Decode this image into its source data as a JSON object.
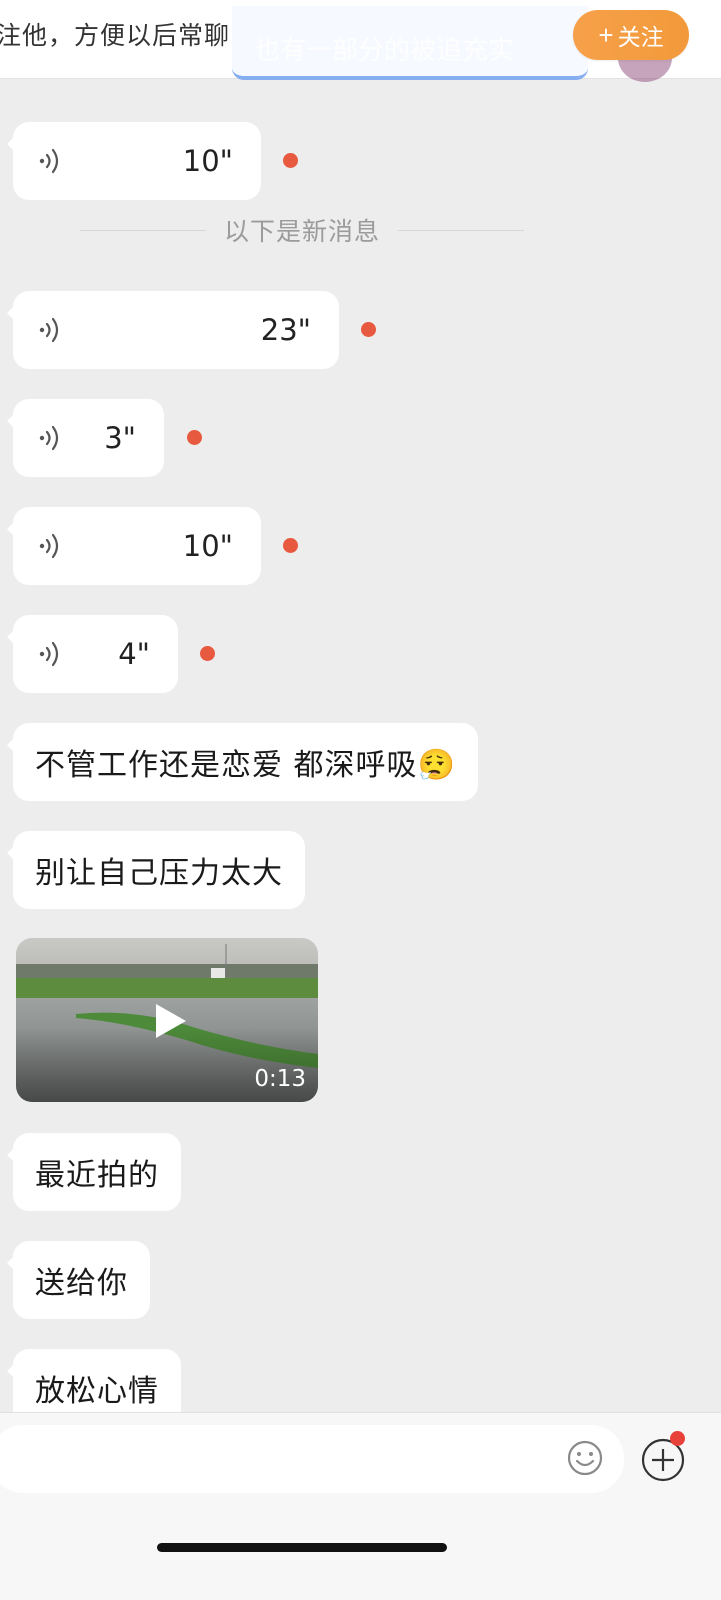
{
  "banner": {
    "text": "注他，方便以后常聊",
    "ghost_text": "也有一部分的被追充实",
    "follow_label": "关注",
    "follow_plus": "+"
  },
  "messages": {
    "voice_1": {
      "duration": "10\""
    },
    "divider": "以下是新消息",
    "voice_2": {
      "duration": "23\""
    },
    "voice_3": {
      "duration": "3\""
    },
    "voice_4": {
      "duration": "10\""
    },
    "voice_5": {
      "duration": "4\""
    },
    "text_1": "不管工作还是恋爱 都深呼吸😮‍💨",
    "text_2": "别让自己压力太大",
    "video": {
      "duration": "0:13"
    },
    "text_3": "最近拍的",
    "text_4": "送给你",
    "text_5": "放松心情"
  },
  "input": {
    "placeholder": ""
  },
  "colors": {
    "accent_orange": "#f29a3a",
    "unread_red": "#e85a3f",
    "background": "#ededed"
  },
  "icons": [
    "voice-wave-icon",
    "play-icon",
    "emoji-icon",
    "plus-circle-icon"
  ]
}
